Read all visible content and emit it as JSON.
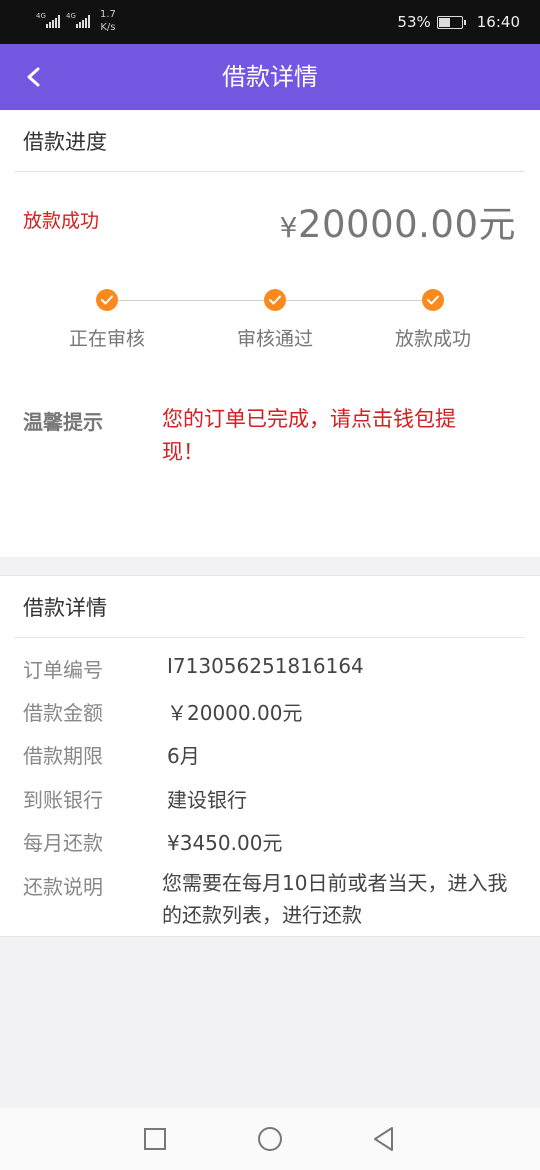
{
  "status_bar": {
    "sim1_label": "4G",
    "sim2_label": "4G",
    "net_speed_value": "1.7",
    "net_speed_unit": "K/s",
    "battery": "53%",
    "battery_level": 0.53,
    "time": "16:40"
  },
  "header": {
    "title": "借款详情",
    "back_icon": "chevron-left-icon"
  },
  "progress": {
    "section_title": "借款进度",
    "status": "放款成功",
    "amount_symbol": "¥",
    "amount_value": "20000.00元",
    "steps": [
      {
        "label": "正在审核",
        "done": true
      },
      {
        "label": "审核通过",
        "done": true
      },
      {
        "label": "放款成功",
        "done": true
      }
    ],
    "step_color": "#fb8a1e",
    "tip_label": "温馨提示",
    "tip_text": "您的订单已完成，请点击钱包提现！"
  },
  "details": {
    "section_title": "借款详情",
    "rows": [
      {
        "label": "订单编号",
        "value": "I713056251816164"
      },
      {
        "label": "借款金额",
        "value": "￥20000.00元"
      },
      {
        "label": "借款期限",
        "value": "6月"
      },
      {
        "label": "到账银行",
        "value": "建设银行"
      },
      {
        "label": "每月还款",
        "value": "¥3450.00元"
      },
      {
        "label": "还款说明",
        "value": "您需要在每月10日前或者当天，进入我的还款列表，进行还款"
      }
    ]
  },
  "nav_bar": {
    "recent_icon": "square-icon",
    "home_icon": "circle-icon",
    "back_icon": "triangle-back-icon"
  },
  "colors": {
    "header_bg": "#7457e1",
    "accent_red": "#d42020",
    "step_orange": "#fb8a1e"
  }
}
